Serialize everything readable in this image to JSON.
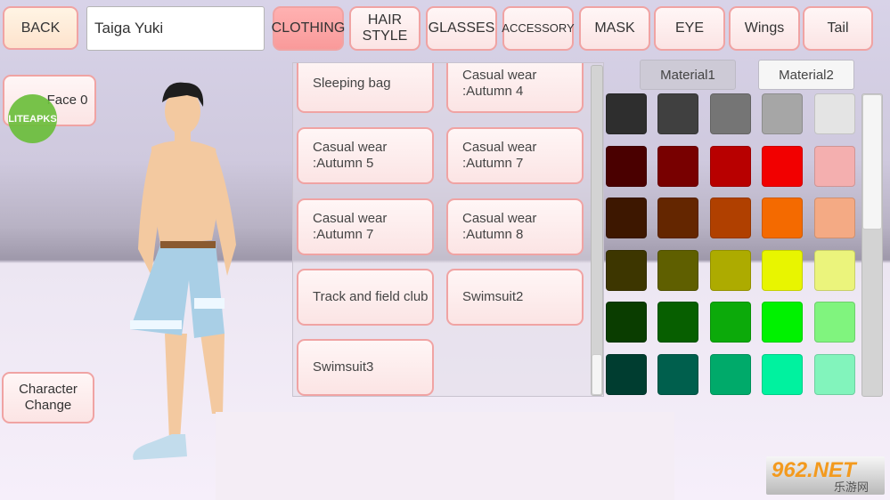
{
  "header": {
    "back_label": "BACK",
    "character_name": "Taiga Yuki",
    "tabs": [
      {
        "label": "CLOTHING",
        "active": true
      },
      {
        "label": "HAIR\nSTYLE"
      },
      {
        "label": "GLASSES"
      },
      {
        "label": "ACCESSORY"
      },
      {
        "label": "MASK"
      },
      {
        "label": "EYE"
      },
      {
        "label": "Wings"
      },
      {
        "label": "Tail"
      }
    ]
  },
  "left": {
    "face_label": "Face 0",
    "character_change_label": "Character\nChange",
    "watermark": "LITEAPKS"
  },
  "clothing_list": {
    "items": [
      "Sleeping bag",
      "Casual wear\n:Autumn 4",
      "Casual wear\n:Autumn 5",
      "Casual wear\n:Autumn 7",
      "Casual wear\n:Autumn 7",
      "Casual wear\n:Autumn 8",
      "Track and field club",
      "Swimsuit2",
      "Swimsuit3"
    ],
    "scroll_position": 1.0
  },
  "materials": {
    "material1": "Material1",
    "material2": "Material2",
    "selected": "Material1"
  },
  "palette": {
    "colors": [
      [
        "#2e2e2e",
        "#404040",
        "#757575",
        "#a6a6a6",
        "#e4e4e4"
      ],
      [
        "#4a0000",
        "#780000",
        "#b80000",
        "#f20000",
        "#f4afaf"
      ],
      [
        "#3d1700",
        "#642600",
        "#b04000",
        "#f46a00",
        "#f4aa84"
      ],
      [
        "#3d3600",
        "#5f5f00",
        "#adab00",
        "#e8f500",
        "#ebf47c"
      ],
      [
        "#0a3d00",
        "#075f00",
        "#0caa0a",
        "#00f200",
        "#80f47e"
      ],
      [
        "#003d30",
        "#005f4d",
        "#00aa6a",
        "#00f29f",
        "#82f4bc"
      ]
    ],
    "scroll_position": 0.0
  },
  "watermark": {
    "text": "962.NET",
    "subtext": "乐游网"
  }
}
